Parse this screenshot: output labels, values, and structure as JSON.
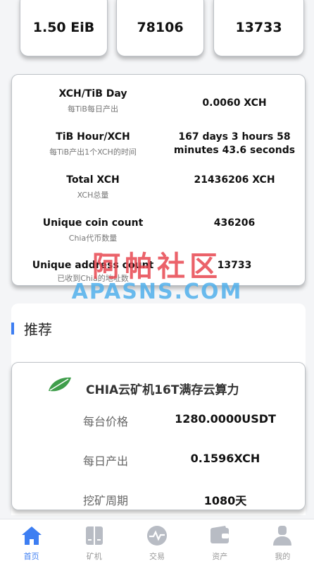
{
  "stats": {
    "space": "1.50 EiB",
    "count_a": "78106",
    "count_b": "13733"
  },
  "metrics": [
    {
      "title": "XCH/TiB Day",
      "subtitle": "每TiB每日产出",
      "value": "0.0060 XCH"
    },
    {
      "title": "TiB Hour/XCH",
      "subtitle": "每TiB产出1个XCH的时间",
      "value": "167 days 3 hours 58 minutes 43.6 seconds"
    },
    {
      "title": "Total XCH",
      "subtitle": "XCH总量",
      "value": "21436206 XCH"
    },
    {
      "title": "Unique coin count",
      "subtitle": "Chia代币数量",
      "value": "436206"
    },
    {
      "title": "Unique address count",
      "subtitle": "已收到Chia的地址数",
      "value": "13733"
    }
  ],
  "watermark": {
    "cn": "阿帕社区",
    "en": "APASNS.COM"
  },
  "recommend": {
    "title": "推荐",
    "product": {
      "icon": "leaf-icon",
      "name": "CHIA云矿机16T满存云算力",
      "rows": [
        {
          "label": "每台价格",
          "value": "1280.0000USDT"
        },
        {
          "label": "每日产出",
          "value": "0.1596XCH"
        },
        {
          "label": "挖矿周期",
          "value": "1080天"
        }
      ]
    }
  },
  "nav": [
    {
      "label": "首页",
      "icon": "home-icon",
      "active": true
    },
    {
      "label": "矿机",
      "icon": "miner-icon",
      "active": false
    },
    {
      "label": "交易",
      "icon": "trade-icon",
      "active": false
    },
    {
      "label": "资产",
      "icon": "wallet-icon",
      "active": false
    },
    {
      "label": "我的",
      "icon": "user-icon",
      "active": false
    }
  ],
  "colors": {
    "accent": "#3d7ef2",
    "nav_inactive": "#b8bcc4",
    "leaf": "#3f9e4b"
  }
}
